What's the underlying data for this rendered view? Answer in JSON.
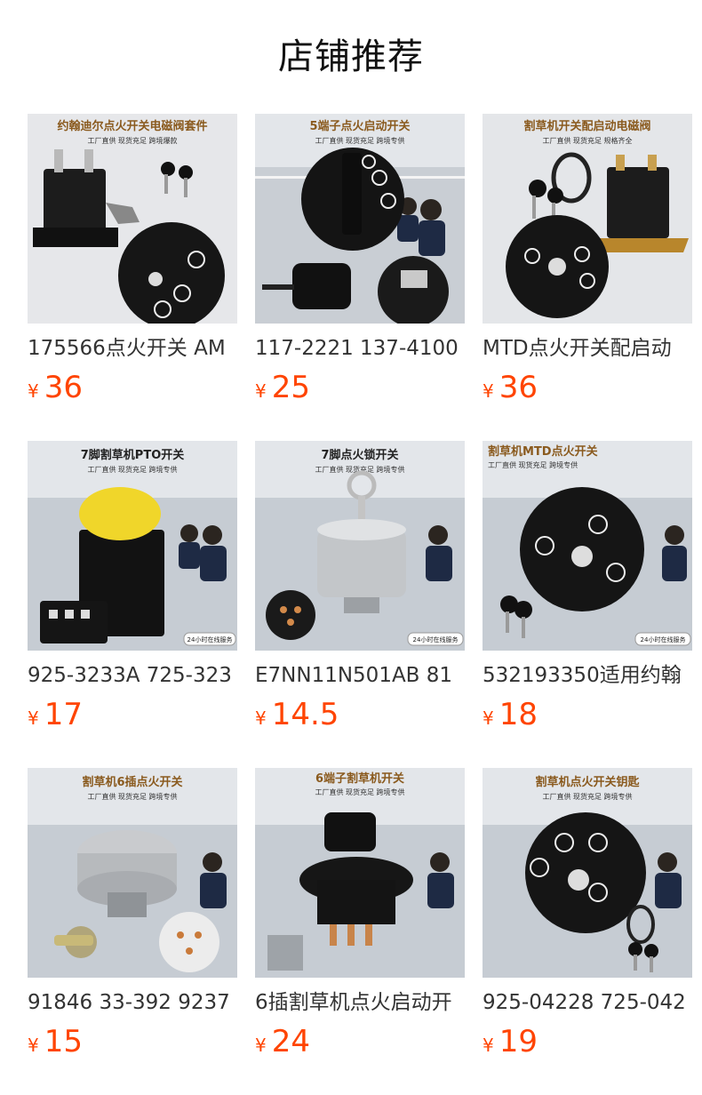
{
  "header": {
    "title": "店铺推荐"
  },
  "colors": {
    "price": "#ff4400",
    "banner_text": "#8a5a1e"
  },
  "currency_symbol": "¥",
  "products": [
    {
      "banner": "约翰迪尔点火开关电磁阀套件",
      "sub": "工厂直供 现货充足 跨境爆款",
      "caption": "175566点火开关 AM",
      "price": "36",
      "service": ""
    },
    {
      "banner": "5端子点火启动开关",
      "sub": "工厂直供 现货充足 跨境专供",
      "caption": "117-2221 137-4100",
      "price": "25",
      "service": ""
    },
    {
      "banner": "割草机开关配启动电磁阀",
      "sub": "工厂直供 现货充足 规格齐全",
      "caption": "MTD点火开关配启动",
      "price": "36",
      "service": ""
    },
    {
      "banner": "7脚割草机PTO开关",
      "sub": "工厂直供 现货充足 跨境专供",
      "caption": "925-3233A 725-323",
      "price": "17",
      "service": "24小时在线服务"
    },
    {
      "banner": "7脚点火锁开关",
      "sub": "工厂直供 现货充足 跨境专供",
      "caption": "E7NN11N501AB 81",
      "price": "14.5",
      "service": "24小时在线服务"
    },
    {
      "banner": "割草机MTD点火开关",
      "sub": "工厂直供 现货充足 跨境专供",
      "caption": "532193350适用约翰",
      "price": "18",
      "service": "24小时在线服务"
    },
    {
      "banner": "割草机6插点火开关",
      "sub": "工厂直供 现货充足 跨境专供",
      "caption": "91846 33-392 9237",
      "price": "15",
      "service": ""
    },
    {
      "banner": "6端子割草机开关",
      "sub": "工厂直供 现货充足 跨境专供",
      "caption": "6插割草机点火启动开",
      "price": "24",
      "service": ""
    },
    {
      "banner": "割草机点火开关钥匙",
      "sub": "工厂直供 现货充足 跨境专供",
      "caption": "925-04228 725-042",
      "price": "19",
      "service": ""
    }
  ]
}
